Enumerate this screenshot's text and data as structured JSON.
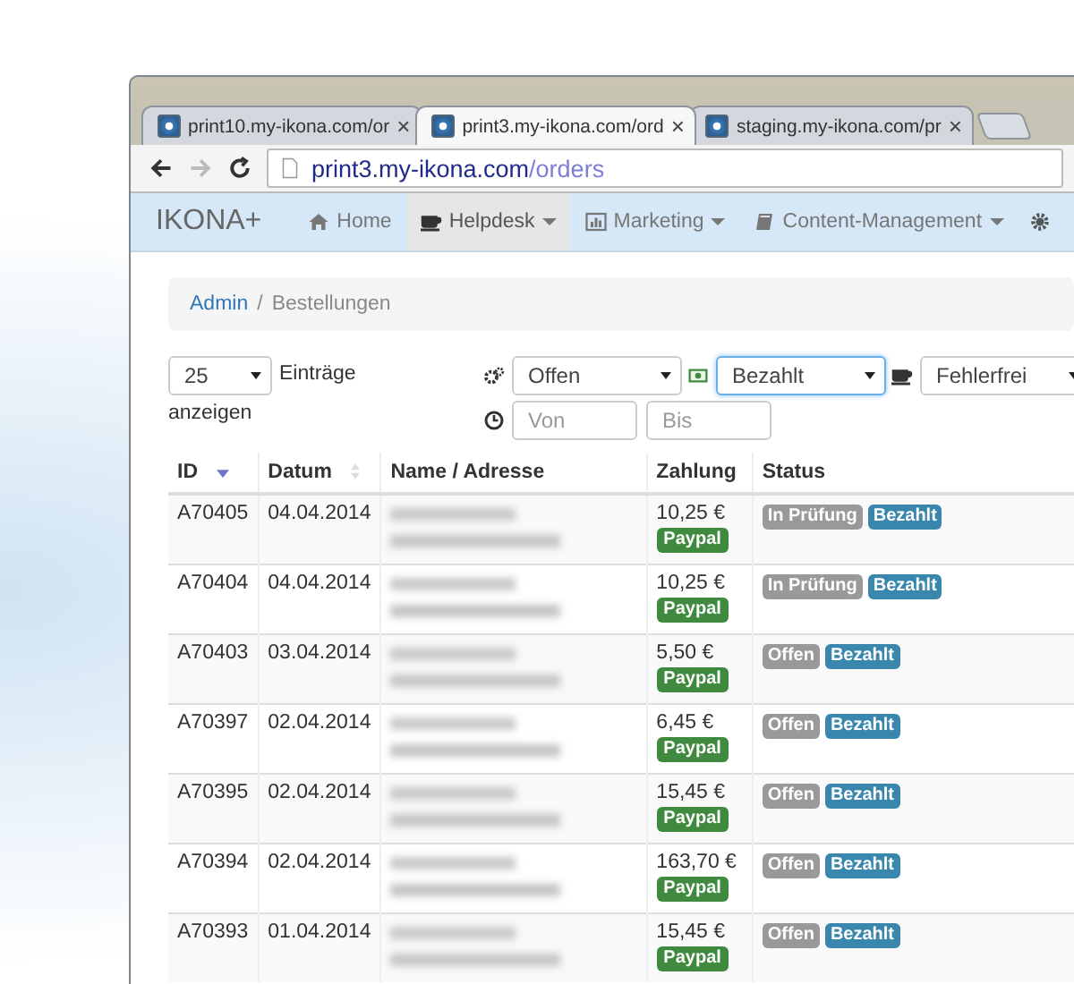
{
  "browser": {
    "tabs": [
      {
        "title": "print10.my-ikona.com/or",
        "selected": false
      },
      {
        "title": "print3.my-ikona.com/ord",
        "selected": true
      },
      {
        "title": "staging.my-ikona.com/pr",
        "selected": false
      }
    ],
    "close_glyph": "×",
    "address": {
      "host": "print3.my-ikona.com",
      "path": "/orders"
    }
  },
  "navbar": {
    "brand": "IKONA+",
    "items": [
      {
        "label": "Home",
        "dropdown": false,
        "selected": false
      },
      {
        "label": "Helpdesk",
        "dropdown": true,
        "selected": true
      },
      {
        "label": "Marketing",
        "dropdown": true,
        "selected": false
      },
      {
        "label": "Content-Management",
        "dropdown": true,
        "selected": false
      }
    ]
  },
  "breadcrumb": {
    "items": [
      "Admin",
      "Bestellungen"
    ],
    "separator": "/"
  },
  "length": {
    "value": "25",
    "label_lines": [
      "Einträge",
      "anzeigen"
    ]
  },
  "filters": [
    {
      "value": "Offen",
      "focused": false
    },
    {
      "value": "Bezahlt",
      "focused": true
    },
    {
      "value": "Fehlerfrei",
      "focused": false
    }
  ],
  "dates": {
    "from": {
      "placeholder": "Von"
    },
    "to": {
      "placeholder": "Bis"
    }
  },
  "table": {
    "columns": [
      {
        "label": "ID"
      },
      {
        "label": "Datum"
      },
      {
        "label": "Name / Adresse"
      },
      {
        "label": "Zahlung"
      },
      {
        "label": "Status"
      }
    ],
    "rows": [
      {
        "id": "A70405",
        "date": "04.04.2014",
        "amount": "10,25 €",
        "payment": "Paypal",
        "statuses": [
          {
            "label": "In Prüfung",
            "color": "#999999"
          },
          {
            "label": "Bezahlt",
            "color": "#3a87ad"
          }
        ]
      },
      {
        "id": "A70404",
        "date": "04.04.2014",
        "amount": "10,25 €",
        "payment": "Paypal",
        "statuses": [
          {
            "label": "In Prüfung",
            "color": "#999999"
          },
          {
            "label": "Bezahlt",
            "color": "#3a87ad"
          }
        ]
      },
      {
        "id": "A70403",
        "date": "03.04.2014",
        "amount": "5,50 €",
        "payment": "Paypal",
        "statuses": [
          {
            "label": "Offen",
            "color": "#999999"
          },
          {
            "label": "Bezahlt",
            "color": "#3a87ad"
          }
        ]
      },
      {
        "id": "A70397",
        "date": "02.04.2014",
        "amount": "6,45 €",
        "payment": "Paypal",
        "statuses": [
          {
            "label": "Offen",
            "color": "#999999"
          },
          {
            "label": "Bezahlt",
            "color": "#3a87ad"
          }
        ]
      },
      {
        "id": "A70395",
        "date": "02.04.2014",
        "amount": "15,45 €",
        "payment": "Paypal",
        "statuses": [
          {
            "label": "Offen",
            "color": "#999999"
          },
          {
            "label": "Bezahlt",
            "color": "#3a87ad"
          }
        ]
      },
      {
        "id": "A70394",
        "date": "02.04.2014",
        "amount": "163,70 €",
        "payment": "Paypal",
        "statuses": [
          {
            "label": "Offen",
            "color": "#999999"
          },
          {
            "label": "Bezahlt",
            "color": "#3a87ad"
          }
        ]
      },
      {
        "id": "A70393",
        "date": "01.04.2014",
        "amount": "15,45 €",
        "payment": "Paypal",
        "statuses": [
          {
            "label": "Offen",
            "color": "#999999"
          },
          {
            "label": "Bezahlt",
            "color": "#3a87ad"
          }
        ]
      }
    ]
  }
}
